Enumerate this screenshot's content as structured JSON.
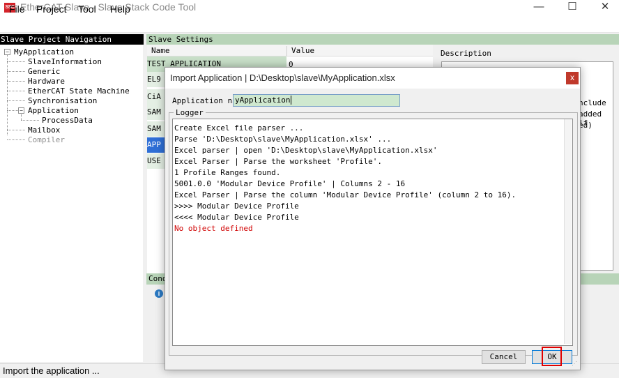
{
  "window": {
    "icon_text": "SSC",
    "title": "EtherCAT Slave - Slave Stack Code Tool",
    "minimize": "—",
    "maximize": "☐",
    "close": "✕"
  },
  "menu": [
    "File",
    "Project",
    "Tool",
    "Help"
  ],
  "nav": {
    "header": "Slave Project Navigation",
    "items": [
      {
        "label": "MyApplication",
        "level": 0,
        "toggle": "−"
      },
      {
        "label": "SlaveInformation",
        "level": 1
      },
      {
        "label": "Generic",
        "level": 1
      },
      {
        "label": "Hardware",
        "level": 1
      },
      {
        "label": "EtherCAT State Machine",
        "level": 1
      },
      {
        "label": "Synchronisation",
        "level": 1
      },
      {
        "label": "Application",
        "level": 1,
        "toggle": "−"
      },
      {
        "label": "ProcessData",
        "level": 2
      },
      {
        "label": "Mailbox",
        "level": 1
      },
      {
        "label": "Compiler",
        "level": 1,
        "disabled": true
      }
    ]
  },
  "settings": {
    "header": "Slave Settings",
    "columns": [
      "Name",
      "Value"
    ],
    "rows": [
      "TEST_APPLICATION",
      "EL9",
      "CiA",
      "SAM",
      "SAM",
      "APP",
      "USE"
    ],
    "first_row_value": "0",
    "description_label": "Description",
    "description_fragments": [
      "nclude",
      "added if",
      "ed)"
    ],
    "conditions_label": "Cond",
    "info_icon": "i"
  },
  "status": "Import the application ...",
  "dialog": {
    "title": "Import Application | D:\\Desktop\\slave\\MyApplication.xlsx",
    "close": "x",
    "app_name_label": "Application name",
    "app_name_value": "yApplication",
    "logger_label": "Logger",
    "log_lines": [
      "Create Excel file parser ...",
      "Parse 'D:\\Desktop\\slave\\MyApplication.xlsx' ...",
      "Excel parser | open 'D:\\Desktop\\slave\\MyApplication.xlsx'",
      "Excel Parser | Parse the worksheet 'Profile'.",
      "1 Profile Ranges found.",
      "5001.0.0 'Modular Device Profile'  | Columns 2 - 16",
      "Excel Parser | Parse the column 'Modular Device Profile' (column 2 to 16).",
      ">>>> Modular Device Profile",
      "<<<< Modular Device Profile"
    ],
    "log_error": "No object defined",
    "cancel_label": "Cancel",
    "ok_label": "OK"
  },
  "colors": {
    "section_header": "#b8d4b8",
    "input_highlight": "#cfe8cf",
    "error_text": "#d00000",
    "annotation_box": "#e00000",
    "close_button": "#c0392b"
  }
}
